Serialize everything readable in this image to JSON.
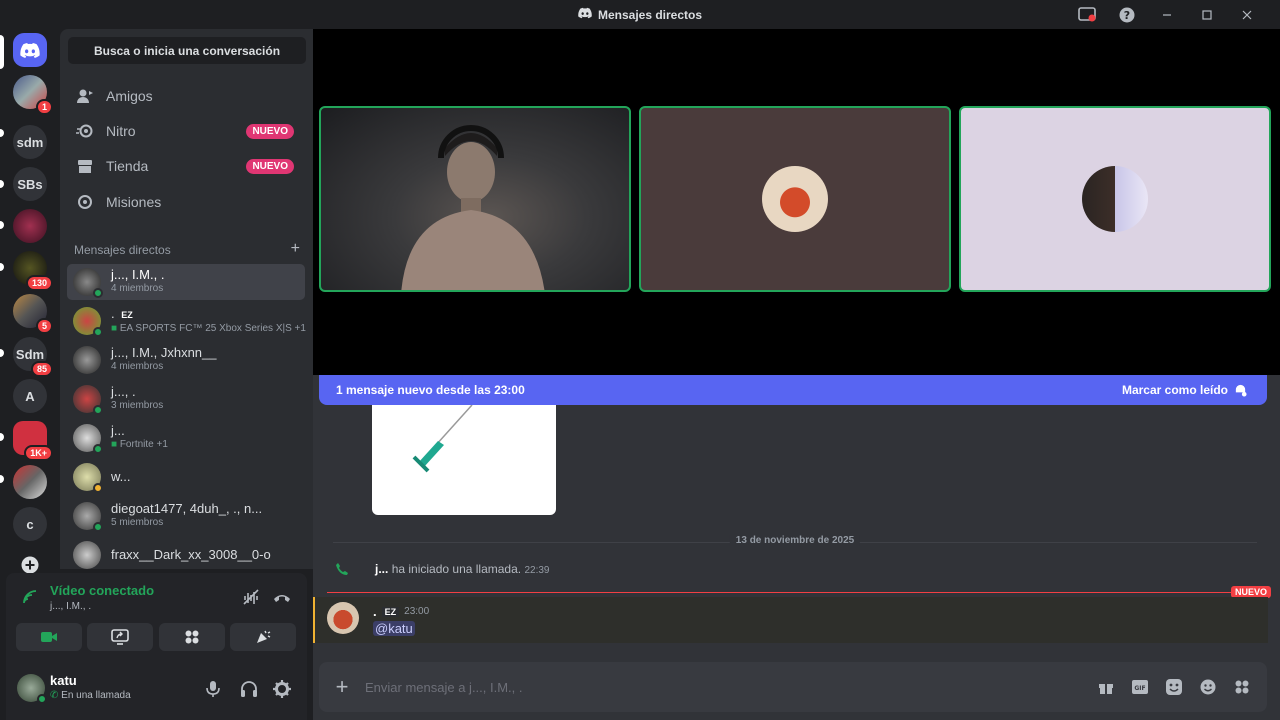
{
  "titlebar": {
    "title": "Mensajes directos"
  },
  "rail": {
    "servers": [
      {
        "label": "",
        "badge": ""
      },
      {
        "label": "",
        "badge": "1"
      },
      {
        "label": "sdm",
        "badge": ""
      },
      {
        "label": "SBs",
        "badge": ""
      },
      {
        "label": "",
        "badge": ""
      },
      {
        "label": "",
        "badge": "130"
      },
      {
        "label": "",
        "badge": "5"
      },
      {
        "label": "Sdm",
        "badge": "85"
      },
      {
        "label": "A",
        "badge": ""
      },
      {
        "label": "",
        "badge": "1K+"
      },
      {
        "label": "",
        "badge": ""
      },
      {
        "label": "c",
        "badge": ""
      }
    ]
  },
  "sidebar": {
    "search": "Busca o inicia una conversación",
    "nav": [
      {
        "label": "Amigos",
        "badge": ""
      },
      {
        "label": "Nitro",
        "badge": "NUEVO"
      },
      {
        "label": "Tienda",
        "badge": "NUEVO"
      },
      {
        "label": "Misiones",
        "badge": ""
      }
    ],
    "dm_header": "Mensajes directos",
    "dms": [
      {
        "name": "j..., I.M., .",
        "sub": "4 miembros"
      },
      {
        "name": ".",
        "tag": "EZ",
        "sub": "EA SPORTS FC™ 25 Xbox Series X|S +1"
      },
      {
        "name": "j..., I.M., Jxhxnn__",
        "sub": "4 miembros"
      },
      {
        "name": "j..., .",
        "sub": "3 miembros"
      },
      {
        "name": "j...",
        "sub": "Fortnite +1"
      },
      {
        "name": "w...",
        "sub": ""
      },
      {
        "name": "diegoat1477, 4duh_, ., n...",
        "sub": "5 miembros"
      },
      {
        "name": "fraxx__Dark_xx_3008__0-o",
        "sub": ""
      }
    ]
  },
  "voice": {
    "status": "Vídeo conectado",
    "channel": "j..., I.M., ."
  },
  "user": {
    "name": "katu",
    "status": "En una llamada"
  },
  "chat": {
    "new_banner": "1 mensaje nuevo desde las 23:00",
    "mark_read": "Marcar como leído",
    "date": "13 de noviembre de 2025",
    "call_user": "j...",
    "call_text": "ha iniciado una llamada.",
    "call_time": "22:39",
    "new_tag": "NUEVO",
    "msg_author": ".",
    "msg_tag": "EZ",
    "msg_time": "23:00",
    "msg_text": "@katu",
    "placeholder": "Enviar mensaje a j..., I.M., ."
  },
  "colors": {
    "accent": "#5865f2",
    "online": "#23a55a",
    "danger": "#f23f43",
    "nuevo": "#e03673"
  }
}
